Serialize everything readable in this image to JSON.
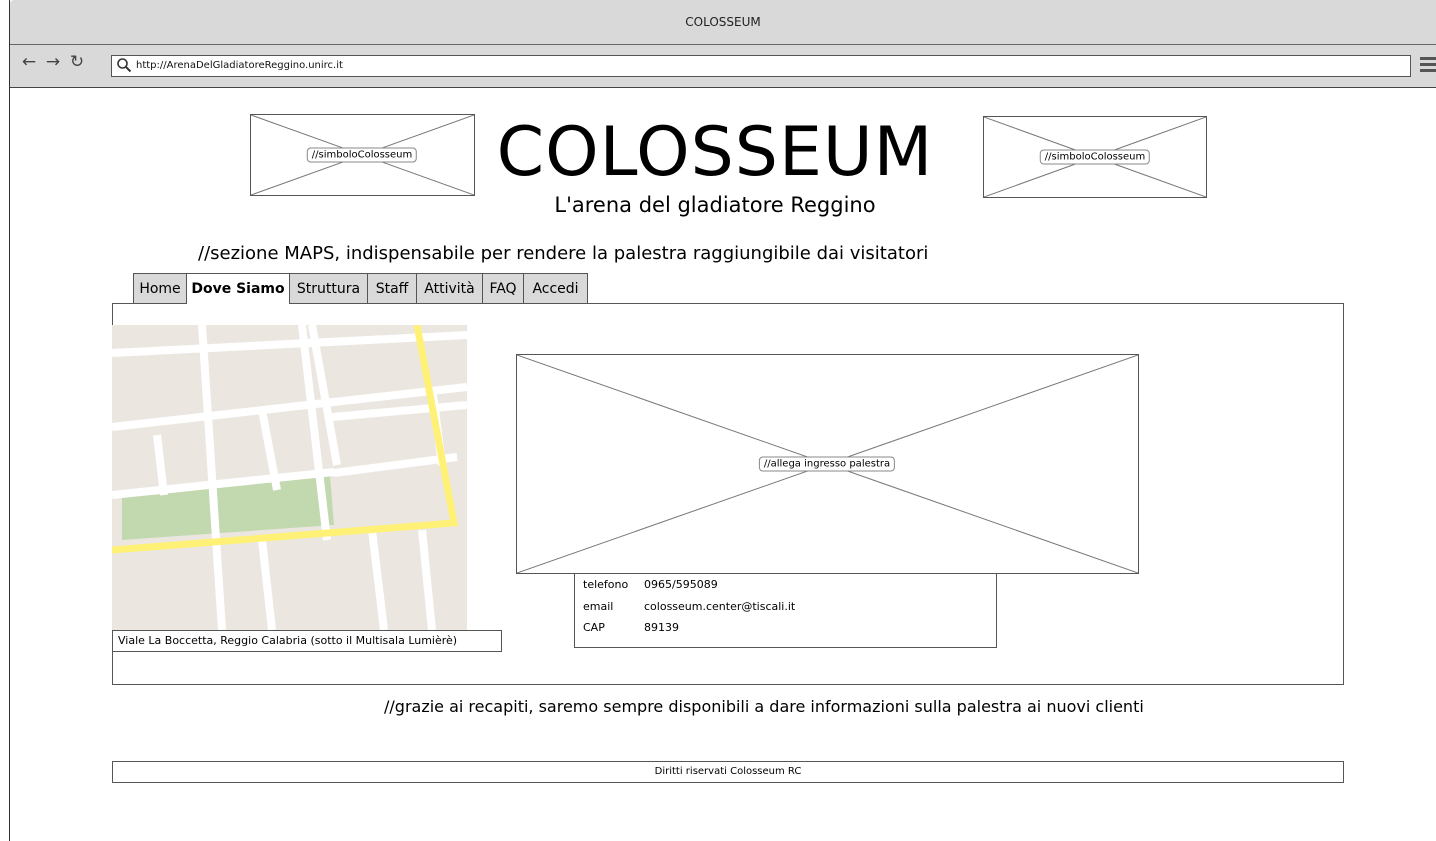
{
  "browser": {
    "window_title": "COLOSSEUM",
    "address": "http://ArenaDelGladiatoreReggino.unirc.it",
    "back_icon": "arrow-left",
    "forward_icon": "arrow-right",
    "reload_icon": "reload",
    "search_icon": "magnifier",
    "menu_icon": "hamburger"
  },
  "header": {
    "left_logo_label": "//simboloColosseum",
    "right_logo_label": "//simboloColosseum",
    "title": "COLOSSEUM",
    "subtitle": "L'arena del gladiatore Reggino"
  },
  "notes": {
    "maps": "//sezione MAPS, indispensabile per rendere la palestra raggiungibile dai visitatori",
    "contacts": "//grazie ai recapiti, saremo sempre disponibili a dare informazioni sulla palestra ai nuovi clienti"
  },
  "tabs": [
    {
      "label": "Home"
    },
    {
      "label": "Dove Siamo",
      "active": true
    },
    {
      "label": "Struttura"
    },
    {
      "label": "Staff"
    },
    {
      "label": "Attività"
    },
    {
      "label": "FAQ"
    },
    {
      "label": "Accedi"
    }
  ],
  "map": {
    "caption": "Viale La Boccetta, Reggio Calabria (sotto il Multisala Lumièrè)",
    "colors": {
      "ground": "#ebe7e0",
      "road": "#ffffff",
      "main_road": "#fff176",
      "park": "#c2d9b0"
    }
  },
  "image_placeholder": {
    "label": "//allega ingresso palestra"
  },
  "contacts": {
    "phone_label": "telefono",
    "phone_value": "0965/595089",
    "email_label": "email",
    "email_value": "colosseum.center@tiscali.it",
    "cap_label": "CAP",
    "cap_value": "89139"
  },
  "footer": {
    "text": "Diritti riservati Colosseum RC"
  }
}
